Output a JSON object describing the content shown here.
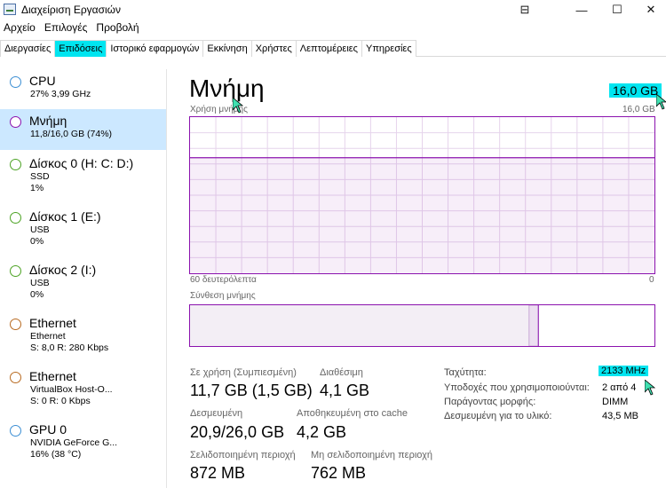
{
  "window": {
    "title": "Διαχείριση Εργασιών",
    "minimize_glyph": "—",
    "maximize_glyph": "☐",
    "close_glyph": "✕",
    "compact_glyph": "⊟"
  },
  "menu": [
    "Αρχείο",
    "Επιλογές",
    "Προβολή"
  ],
  "tabs": [
    "Διεργασίες",
    "Επιδόσεις",
    "Ιστορικό εφαρμογών",
    "Εκκίνηση",
    "Χρήστες",
    "Λεπτομέρειες",
    "Υπηρεσίες"
  ],
  "active_tab": "Επιδόσεις",
  "sidebar": [
    {
      "name": "CPU",
      "sub1": "27%  3,99 GHz",
      "sub2": "",
      "color": "#3c8fd4"
    },
    {
      "name": "Μνήμη",
      "sub1": "11,8/16,0 GB (74%)",
      "sub2": "",
      "color": "#8b12ae"
    },
    {
      "name": "Δίσκος 0 (H: C: D:)",
      "sub1": "SSD",
      "sub2": "1%",
      "color": "#4da325"
    },
    {
      "name": "Δίσκος 1 (E:)",
      "sub1": "USB",
      "sub2": "0%",
      "color": "#4da325"
    },
    {
      "name": "Δίσκος 2 (I:)",
      "sub1": "USB",
      "sub2": "0%",
      "color": "#4da325"
    },
    {
      "name": "Ethernet",
      "sub1": "Ethernet",
      "sub2": "S: 8,0  R: 280 Kbps",
      "color": "#b86b22"
    },
    {
      "name": "Ethernet",
      "sub1": "VirtualBox Host-O...",
      "sub2": "S: 0  R: 0 Kbps",
      "color": "#b86b22"
    },
    {
      "name": "GPU 0",
      "sub1": "NVIDIA GeForce G...",
      "sub2": "16%  (38 °C)",
      "color": "#3c8fd4"
    }
  ],
  "main": {
    "title": "Μνήμη",
    "total": "16,0 GB",
    "usage_label": "Χρήση μνήμης",
    "usage_max": "16,0 GB",
    "time_label": "60 δευτερόλεπτα",
    "time_min": "0",
    "composition_label": "Σύνθεση μνήμης",
    "usage_fraction": 0.74,
    "composition": {
      "in_use": 0.73,
      "modified": 0.02
    }
  },
  "stats": [
    {
      "label": "Σε χρήση (Συμπιεσμένη)",
      "value": "11,7 GB (1,5 GB)"
    },
    {
      "label": "Διαθέσιμη",
      "value": "4,1 GB"
    },
    {
      "label": "Δεσμευμένη",
      "value": "20,9/26,0 GB"
    },
    {
      "label": "Αποθηκευμένη στο cache",
      "value": "4,2 GB"
    },
    {
      "label": "Σελιδοποιημένη περιοχή",
      "value": "872 MB"
    },
    {
      "label": "Μη σελιδοποιημένη περιοχή",
      "value": "762 MB"
    }
  ],
  "specs": [
    {
      "label": "Ταχύτητα:",
      "value": "2133 MHz"
    },
    {
      "label": "Υποδοχές που χρησιμοποιούνται:",
      "value": "2 από 4"
    },
    {
      "label": "Παράγοντας μορφής:",
      "value": "DIMM"
    },
    {
      "label": "Δεσμευμένη για το υλικό:",
      "value": "43,5 MB"
    }
  ],
  "colors": {
    "accent": "#00e5f0",
    "memory": "#8b12ae",
    "selected": "#cce8ff"
  }
}
